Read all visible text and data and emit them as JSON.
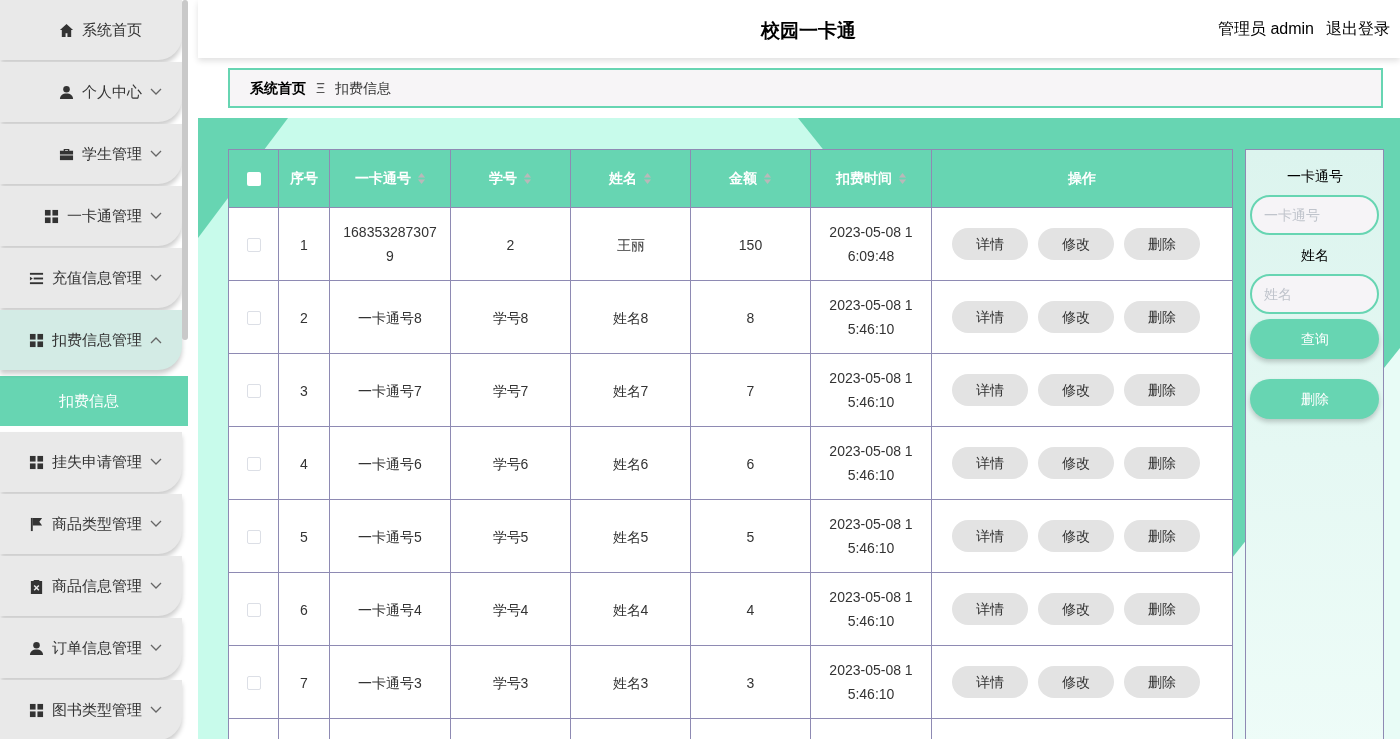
{
  "header": {
    "title": "校园一卡通",
    "user": "管理员 admin",
    "logout": "退出登录"
  },
  "sidebar": {
    "items": [
      {
        "label": "系统首页",
        "kind": "link"
      },
      {
        "label": "个人中心",
        "kind": "menu",
        "expanded": false
      },
      {
        "label": "学生管理",
        "kind": "menu",
        "expanded": false
      },
      {
        "label": "一卡通管理",
        "kind": "menu",
        "expanded": false
      },
      {
        "label": "充值信息管理",
        "kind": "menu",
        "expanded": false
      },
      {
        "label": "扣费信息管理",
        "kind": "menu",
        "expanded": true,
        "children": [
          {
            "label": "扣费信息",
            "selected": true
          }
        ]
      },
      {
        "label": "挂失申请管理",
        "kind": "menu",
        "expanded": false
      },
      {
        "label": "商品类型管理",
        "kind": "menu",
        "expanded": false
      },
      {
        "label": "商品信息管理",
        "kind": "menu",
        "expanded": false
      },
      {
        "label": "订单信息管理",
        "kind": "menu",
        "expanded": false
      },
      {
        "label": "图书类型管理",
        "kind": "menu",
        "expanded": false
      }
    ]
  },
  "breadcrumb": {
    "items": [
      "系统首页",
      "扣费信息"
    ],
    "separator": "Ξ"
  },
  "table": {
    "select_all_checked": false,
    "columns": [
      {
        "label": "序号",
        "sortable": false
      },
      {
        "label": "一卡通号",
        "sortable": true
      },
      {
        "label": "学号",
        "sortable": true
      },
      {
        "label": "姓名",
        "sortable": true
      },
      {
        "label": "金额",
        "sortable": true
      },
      {
        "label": "扣费时间",
        "sortable": true
      },
      {
        "label": "操作",
        "sortable": false
      }
    ],
    "rows": [
      {
        "checked": false,
        "cells": [
          "1",
          "1683532873079",
          "2",
          "王丽",
          "150",
          "2023-05-08 16:09:48"
        ],
        "actions": [
          "详情",
          "修改",
          "删除"
        ]
      },
      {
        "checked": false,
        "cells": [
          "2",
          "一卡通号8",
          "学号8",
          "姓名8",
          "8",
          "2023-05-08 15:46:10"
        ],
        "actions": [
          "详情",
          "修改",
          "删除"
        ]
      },
      {
        "checked": false,
        "cells": [
          "3",
          "一卡通号7",
          "学号7",
          "姓名7",
          "7",
          "2023-05-08 15:46:10"
        ],
        "actions": [
          "详情",
          "修改",
          "删除"
        ]
      },
      {
        "checked": false,
        "cells": [
          "4",
          "一卡通号6",
          "学号6",
          "姓名6",
          "6",
          "2023-05-08 15:46:10"
        ],
        "actions": [
          "详情",
          "修改",
          "删除"
        ]
      },
      {
        "checked": false,
        "cells": [
          "5",
          "一卡通号5",
          "学号5",
          "姓名5",
          "5",
          "2023-05-08 15:46:10"
        ],
        "actions": [
          "详情",
          "修改",
          "删除"
        ]
      },
      {
        "checked": false,
        "cells": [
          "6",
          "一卡通号4",
          "学号4",
          "姓名4",
          "4",
          "2023-05-08 15:46:10"
        ],
        "actions": [
          "详情",
          "修改",
          "删除"
        ]
      },
      {
        "checked": false,
        "cells": [
          "7",
          "一卡通号3",
          "学号3",
          "姓名3",
          "3",
          "2023-05-08 15:46:10"
        ],
        "actions": [
          "详情",
          "修改",
          "删除"
        ]
      }
    ]
  },
  "search_panel": {
    "fields": [
      {
        "label": "一卡通号",
        "placeholder": "一卡通号"
      },
      {
        "label": "姓名",
        "placeholder": "姓名"
      }
    ],
    "buttons": [
      "查询",
      "删除"
    ]
  }
}
